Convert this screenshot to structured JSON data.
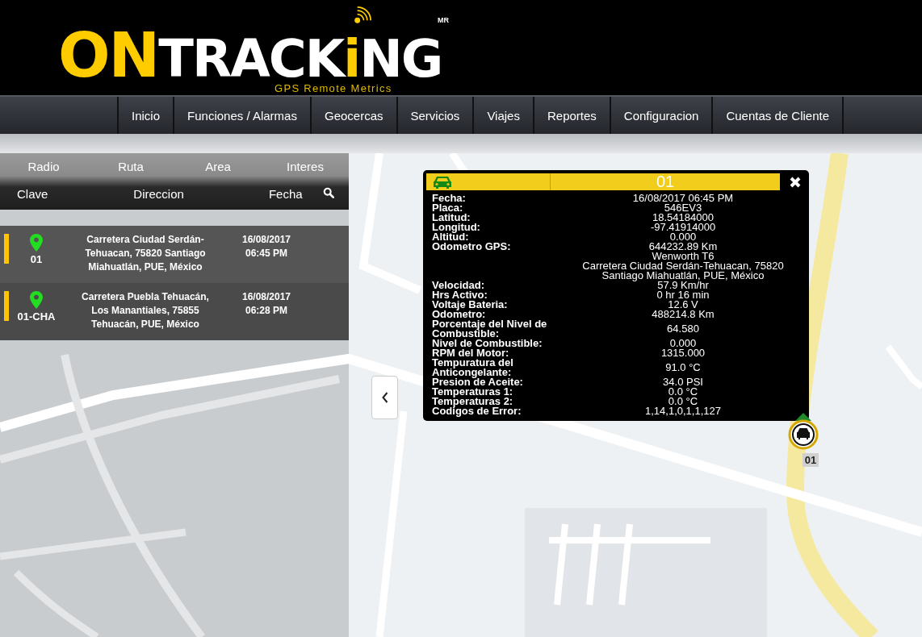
{
  "header": {
    "logo": {
      "parts": [
        {
          "text": "ON",
          "color": "#ffcc00"
        },
        {
          "text": "TRACK",
          "color": "#ffffff"
        },
        {
          "text": "i",
          "color": "#ffcc00"
        },
        {
          "text": "NG",
          "color": "#ffffff"
        }
      ],
      "mark": "MR",
      "tagline": "GPS Remote Metrics"
    }
  },
  "nav": {
    "items": [
      "Inicio",
      "Funciones / Alarmas",
      "Geocercas",
      "Servicios",
      "Viajes",
      "Reportes",
      "Configuracion",
      "Cuentas de Cliente"
    ]
  },
  "sidebar": {
    "filter_tabs": [
      "Radio",
      "Ruta",
      "Area",
      "Interes"
    ],
    "columns": [
      "Clave",
      "Direccion",
      "Fecha"
    ],
    "vehicles": [
      {
        "id": "01",
        "address": "Carretera Ciudad Serdán-Tehuacan, 75820 Santiago Miahuatlán, PUE, México",
        "date": "16/08/2017",
        "time": "06:45 PM"
      },
      {
        "id": "01-CHA",
        "address": "Carretera Puebla Tehuacán, Los Manantiales, 75855 Tehuacán, PUE, México",
        "date": "16/08/2017",
        "time": "06:28 PM"
      }
    ]
  },
  "popup": {
    "title": "01",
    "rows": [
      {
        "label": "Fecha:",
        "value": "16/08/2017 06:45 PM"
      },
      {
        "label": "Placa:",
        "value": "546EV3"
      },
      {
        "label": "Latitud:",
        "value": "18.54184000"
      },
      {
        "label": "Longitud:",
        "value": "-97.41914000"
      },
      {
        "label": "Altitud:",
        "value": "0.000"
      },
      {
        "label": "Odometro GPS:",
        "value": "644232.89 Km"
      },
      {
        "value": "Wenworth T6"
      },
      {
        "value": "Carretera Ciudad Serdán-Tehuacan, 75820 Santiago Miahuatlán, PUE, México"
      },
      {
        "label": "Velocidad:",
        "value": "57.9 Km/hr"
      },
      {
        "label": "Hrs Activo:",
        "value": "0 hr 16 min"
      },
      {
        "label": "Voltaje Bateria:",
        "value": "12.6 V"
      },
      {
        "label": "Odometro:",
        "value": "488214.8 Km"
      },
      {
        "label": "Porcentaje del Nivel de Combustible:",
        "value": "64.580"
      },
      {
        "label": "Nivel de Combustible:",
        "value": "0.000"
      },
      {
        "label": "RPM del Motor:",
        "value": "1315.000"
      },
      {
        "label": "Tempuratura del Anticongelante:",
        "value": "91.0 °C"
      },
      {
        "label": "Presion de Aceite:",
        "value": "34.0 PSI"
      },
      {
        "label": "Temperaturas 1:",
        "value": "0.0 °C"
      },
      {
        "label": "Temperaturas 2:",
        "value": "0.0 °C"
      },
      {
        "label": "Codigos de Error:",
        "value": "1,14,1,0,1,1,127"
      }
    ]
  },
  "marker": {
    "label": "01"
  }
}
